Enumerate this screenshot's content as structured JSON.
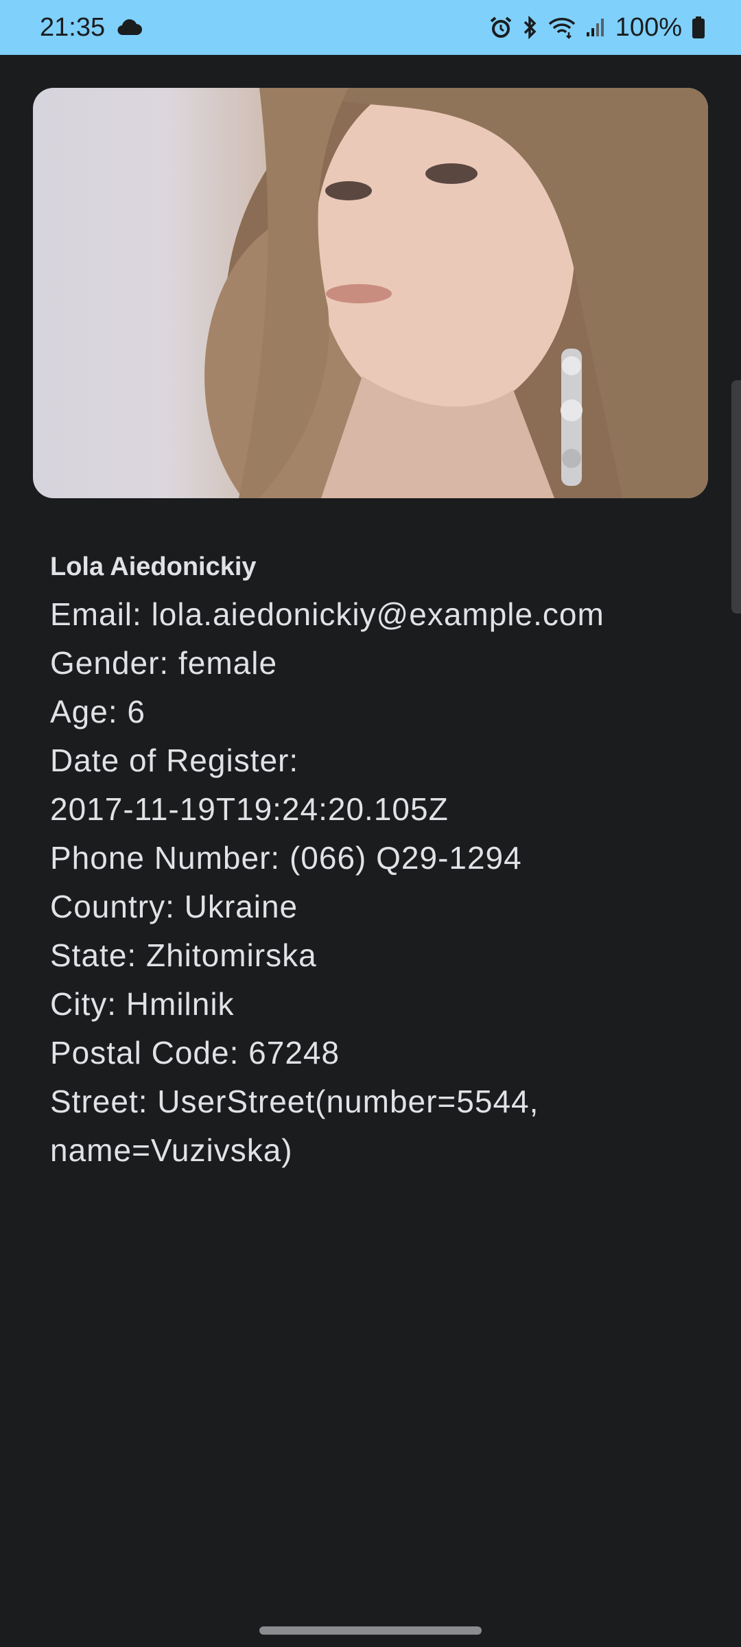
{
  "status_bar": {
    "time": "21:35",
    "battery": "100%",
    "icons": [
      "cloud-icon",
      "alarm-icon",
      "bluetooth-icon",
      "wifi-icon",
      "signal-icon",
      "battery-icon"
    ]
  },
  "profile": {
    "name": "Lola Aiedonickiy",
    "email": "Email: lola.aiedonickiy@example.com",
    "gender": "Gender: female",
    "age": "Age: 6",
    "register_label": "Date of Register:",
    "register_value": "2017-11-19T19:24:20.105Z",
    "phone": "Phone Number: (066) Q29-1294",
    "country": "Country: Ukraine",
    "state": "State: Zhitomirska",
    "city": "City: Hmilnik",
    "postal": "Postal Code: 67248",
    "street_line1": "Street: UserStreet(number=5544,",
    "street_line2": "name=Vuzivska)"
  },
  "colors": {
    "status_bar_bg": "#7fd0fb",
    "background": "#1a1c1e",
    "text": "#e2e2e6"
  }
}
